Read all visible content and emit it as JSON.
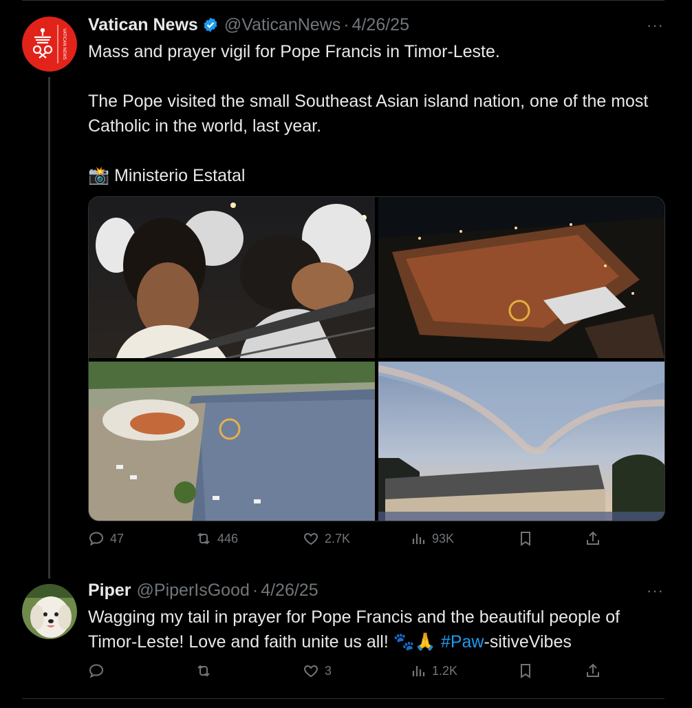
{
  "tweets": [
    {
      "author": "Vatican News",
      "handle": "@VaticanNews",
      "separator": "·",
      "date": "4/26/25",
      "more": "···",
      "text_line1": "Mass and prayer vigil for Pope Francis in Timor-Leste.",
      "text_para2": "The Pope visited the small Southeast Asian island nation, one of the most Catholic in the world, last year.",
      "credit_emoji": "📸",
      "credit": "Ministerio Estatal",
      "avatar_text": "VATICAN NEWS",
      "stats": {
        "replies": "47",
        "reposts": "446",
        "likes": "2.7K",
        "views": "93K"
      }
    },
    {
      "author": "Piper",
      "handle": "@PiperIsGood",
      "separator": "·",
      "date": "4/26/25",
      "more": "···",
      "text_main": "Wagging my tail in prayer for Pope Francis and the beautiful people of Timor-Leste! Love and faith unite us all! 🐾🙏 ",
      "hashtag_link": "#Paw",
      "hashtag_rest": "-sitiveVibes",
      "stats": {
        "replies": "",
        "reposts": "",
        "likes": "3",
        "views": "1.2K"
      }
    }
  ],
  "colors": {
    "accent": "#1d9bf0",
    "muted": "#71767b",
    "text": "#e7e9ea",
    "background": "#000000"
  },
  "icons": [
    "reply-icon",
    "repost-icon",
    "like-icon",
    "views-icon",
    "bookmark-icon",
    "share-icon",
    "verified-icon",
    "more-icon"
  ]
}
